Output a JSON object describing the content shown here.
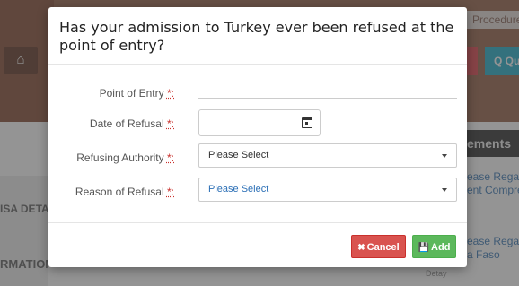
{
  "background": {
    "procedure_text": "Procedure",
    "search_button_text": "Q Qu",
    "requirements_text": "ements",
    "visa_details_text": "ISA DETA",
    "information_text": "RMATION",
    "links": [
      "ease Regard",
      "ent Compre",
      "ease Regard",
      "a Faso"
    ],
    "detail_text": "Detay"
  },
  "modal": {
    "title": "Has your admission to Turkey ever been refused at the point of entry?",
    "fields": {
      "point_of_entry": {
        "label": "Point of Entry",
        "required_mark": "*:",
        "value": ""
      },
      "date_of_refusal": {
        "label": "Date of Refusal",
        "required_mark": "*:",
        "value": ""
      },
      "refusing_authority": {
        "label": "Refusing Authority",
        "required_mark": "*:",
        "selected": "Please Select"
      },
      "reason_of_refusal": {
        "label": "Reason of Refusal",
        "required_mark": "*:",
        "selected": "Please Select"
      }
    },
    "buttons": {
      "cancel": "Cancel",
      "add": "Add"
    }
  },
  "icons": {
    "home": "home-icon",
    "calendar": "calendar-icon",
    "cancel": "times-icon",
    "add": "save-icon",
    "dropdown": "caret-down-icon"
  },
  "colors": {
    "cancel": "#d9534f",
    "add": "#5cb85c",
    "required": "#c9302c",
    "select_blue": "#2b6fb6"
  }
}
